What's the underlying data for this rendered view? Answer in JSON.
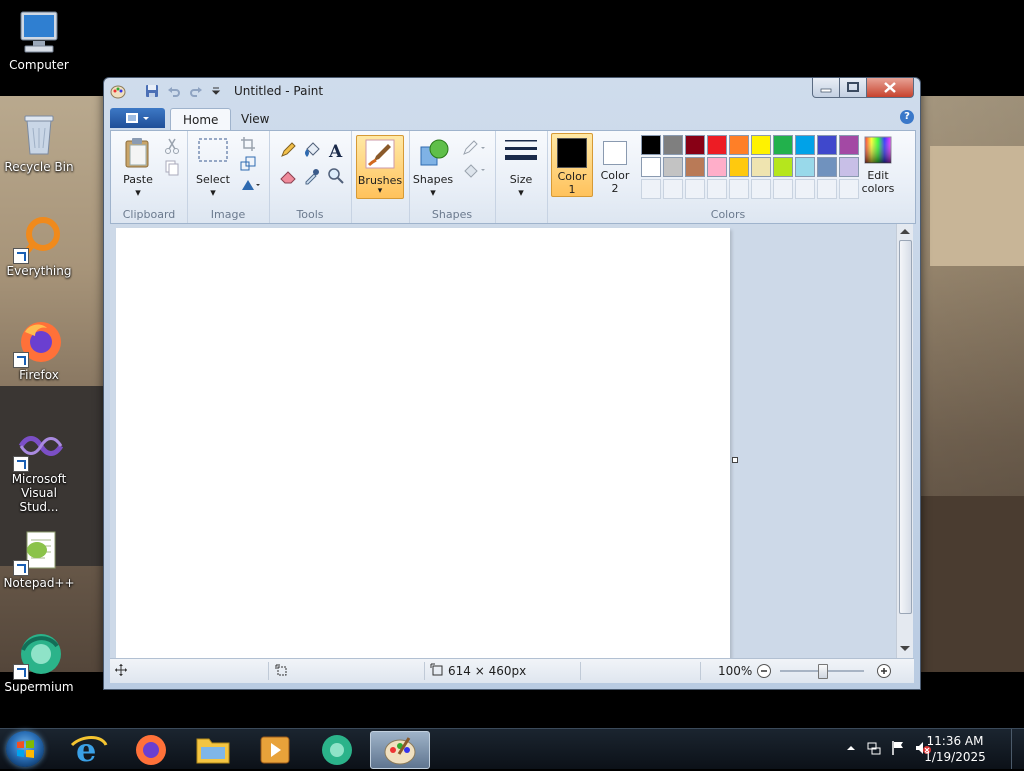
{
  "desktop": {
    "icons": [
      {
        "label": "Computer"
      },
      {
        "label": "Recycle Bin"
      },
      {
        "label": "Everything"
      },
      {
        "label": "Firefox"
      },
      {
        "label": "Microsoft Visual Stud..."
      },
      {
        "label": "Notepad++"
      },
      {
        "label": "Supermium"
      }
    ]
  },
  "window": {
    "title": "Untitled - Paint"
  },
  "ribbon": {
    "tabs": [
      "Home",
      "View"
    ],
    "groups": {
      "clipboard": {
        "label": "Clipboard",
        "paste": "Paste"
      },
      "image": {
        "label": "Image",
        "select": "Select"
      },
      "tools": {
        "label": "Tools"
      },
      "brushes": {
        "label": "Brushes"
      },
      "shapes": {
        "label": "Shapes",
        "shapes_button": "Shapes"
      },
      "size": {
        "label": "Size"
      },
      "colors": {
        "label": "Colors",
        "color1_line1": "Color",
        "color1_line2": "1",
        "color2_line1": "Color",
        "color2_line2": "2",
        "edit_line1": "Edit",
        "edit_line2": "colors",
        "palette_row1": [
          "#000000",
          "#7f7f7f",
          "#880015",
          "#ed1c24",
          "#ff7f27",
          "#fff200",
          "#22b14c",
          "#00a2e8",
          "#3f48cc",
          "#a349a4"
        ],
        "palette_row2": [
          "#ffffff",
          "#c3c3c3",
          "#b97a57",
          "#ffaec9",
          "#ffc90e",
          "#efe4b0",
          "#b5e61d",
          "#99d9ea",
          "#7092be",
          "#c8bfe7"
        ],
        "color1": "#000000",
        "color2": "#ffffff"
      }
    }
  },
  "statusbar": {
    "dimensions": "614 × 460px",
    "zoom": "100%"
  },
  "taskbar": {
    "time": "11:36 AM",
    "date": "1/19/2025"
  }
}
